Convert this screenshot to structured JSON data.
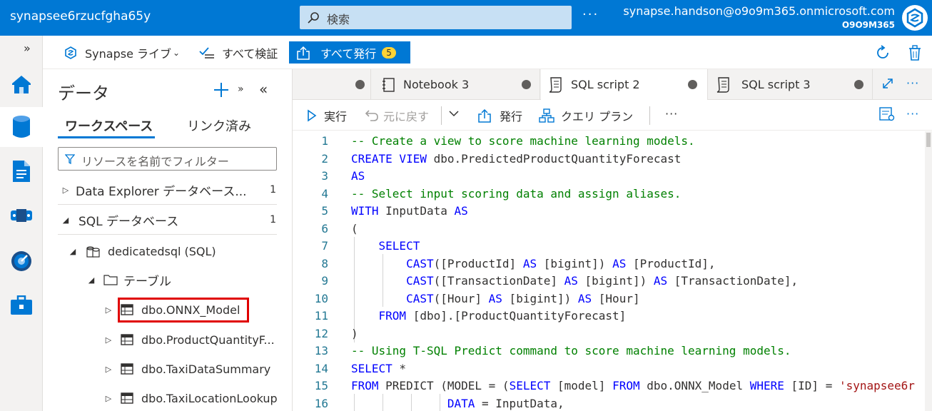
{
  "header": {
    "workspace": "synapsee6rzucfgha65y",
    "search_placeholder": "検索",
    "more": "···",
    "user_email": "synapse.handson@o9o9m365.onmicrosoft.com",
    "tenant": "O9O9M365"
  },
  "rail": {
    "expand": "»",
    "items": [
      "home-icon",
      "data-icon",
      "develop-icon",
      "integrate-icon",
      "monitor-icon",
      "manage-icon"
    ]
  },
  "commandbar": {
    "live": "Synapse ライブ",
    "validate_all": "すべて検証",
    "publish_all": "すべて発行",
    "publish_count": "5"
  },
  "data_panel": {
    "title": "データ",
    "tabs": [
      "ワークスペース",
      "リンク済み"
    ],
    "filter_placeholder": "リソースを名前でフィルター",
    "sections": [
      {
        "label": "Data Explorer データベース...",
        "count": "1"
      },
      {
        "label": "SQL データベース",
        "count": "1"
      }
    ],
    "database": "dedicatedsql (SQL)",
    "folder": "テーブル",
    "tables": [
      "dbo.ONNX_Model",
      "dbo.ProductQuantityF...",
      "dbo.TaxiDataSummary",
      "dbo.TaxiLocationLookup"
    ]
  },
  "editor_tabs": [
    {
      "label": "Notebook 3"
    },
    {
      "label": "SQL script 2"
    },
    {
      "label": "SQL script 3"
    }
  ],
  "editor_toolbar": {
    "run": "実行",
    "undo": "元に戻す",
    "publish": "発行",
    "query_plan": "クエリ プラン",
    "more": "···"
  },
  "code_lines": [
    "-- Create a view to score machine learning models.",
    "CREATE VIEW dbo.PredictedProductQuantityForecast",
    "AS",
    "-- Select input scoring data and assign aliases.",
    "WITH InputData AS",
    "(",
    "    SELECT",
    "        CAST([ProductId] AS [bigint]) AS [ProductId],",
    "        CAST([TransactionDate] AS [bigint]) AS [TransactionDate],",
    "        CAST([Hour] AS [bigint]) AS [Hour]",
    "    FROM [dbo].[ProductQuantityForecast]",
    ")",
    "-- Using T-SQL Predict command to score machine learning models.",
    "SELECT *",
    "FROM PREDICT (MODEL = (SELECT [model] FROM dbo.ONNX_Model WHERE [ID] = 'synapsee6r",
    "              DATA = InputData,"
  ],
  "line_numbers": [
    "1",
    "2",
    "3",
    "4",
    "5",
    "6",
    "7",
    "8",
    "9",
    "10",
    "11",
    "12",
    "13",
    "14",
    "15",
    "16"
  ],
  "colors": {
    "accent": "#0078d4",
    "keyword": "#0000ff",
    "comment": "#008000",
    "string": "#a31515",
    "highlight": "#e00000"
  }
}
